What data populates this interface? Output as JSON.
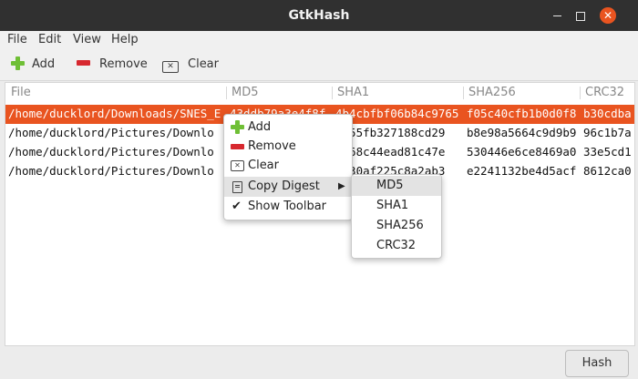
{
  "window": {
    "title": "GtkHash"
  },
  "menu": [
    "File",
    "Edit",
    "View",
    "Help"
  ],
  "toolbar": {
    "add": "Add",
    "remove": "Remove",
    "clear": "Clear"
  },
  "table": {
    "headers": [
      "File",
      "MD5",
      "SHA1",
      "SHA256",
      "CRC32"
    ],
    "rows": [
      [
        "/home/ducklord/Downloads/SNES_E",
        "43ddb79a3e4f8f",
        "4b4cbfbf06b84c9765",
        "f05c40cfb1b0d0f8",
        "b30cdba"
      ],
      [
        "/home/ducklord/Pictures/Downlo",
        "",
        "6b55fb327188cd29",
        "b8e98a5664c9d9b9",
        "96c1b7a"
      ],
      [
        "/home/ducklord/Pictures/Downlo",
        "",
        "c968c44ead81c47e",
        "530446e6ce8469a0",
        "33e5cd1"
      ],
      [
        "/home/ducklord/Pictures/Downlo",
        "",
        "4930af225c8a2ab3",
        "e2241132be4d5acf",
        "8612ca0"
      ]
    ]
  },
  "context_menu": {
    "add": "Add",
    "remove": "Remove",
    "clear": "Clear",
    "copy_digest": "Copy Digest",
    "show_toolbar": "Show Toolbar"
  },
  "submenu": [
    "MD5",
    "SHA1",
    "SHA256",
    "CRC32"
  ],
  "hash_button": "Hash",
  "colors": {
    "titlebar": "#303030",
    "selection": "#e95420",
    "add_icon": "#6fbf35",
    "remove_icon": "#d7282f"
  }
}
